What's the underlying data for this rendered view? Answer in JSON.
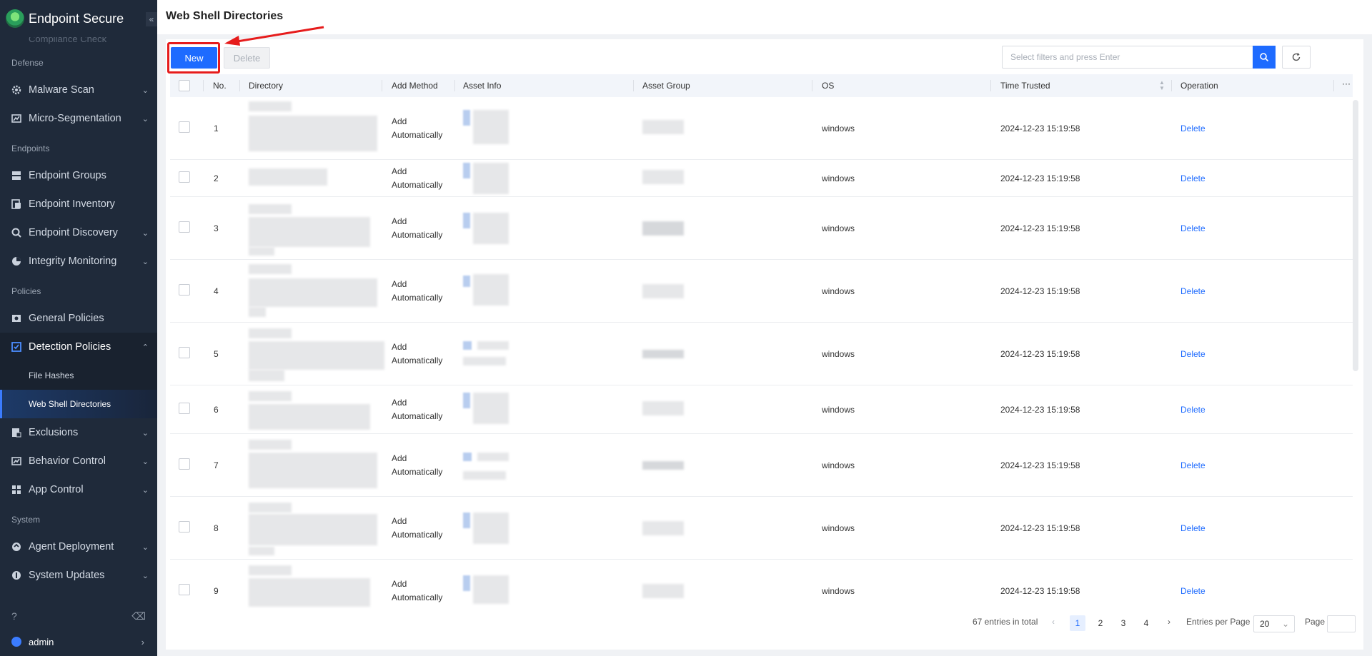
{
  "sidebar": {
    "brand": "Endpoint Secure",
    "collapse_icon": "«",
    "cut_item": "Compliance Check",
    "sections": [
      {
        "label": "Defense",
        "items": [
          {
            "label": "Malware Scan",
            "icon": "gear-icon"
          },
          {
            "label": "Micro-Segmentation",
            "icon": "segment-icon"
          }
        ]
      },
      {
        "label": "Endpoints",
        "items": [
          {
            "label": "Endpoint Groups",
            "icon": "groups-icon"
          },
          {
            "label": "Endpoint Inventory",
            "icon": "inventory-icon"
          },
          {
            "label": "Endpoint Discovery",
            "icon": "discovery-icon"
          },
          {
            "label": "Integrity Monitoring",
            "icon": "pie-icon"
          }
        ]
      },
      {
        "label": "Policies",
        "items": [
          {
            "label": "General Policies",
            "icon": "policy-icon"
          },
          {
            "label": "Detection Policies",
            "icon": "detection-icon"
          }
        ]
      }
    ],
    "detection_sub": [
      "File Hashes",
      "Web Shell Directories"
    ],
    "policies_more": [
      {
        "label": "Exclusions",
        "icon": "exclusions-icon"
      },
      {
        "label": "Behavior Control",
        "icon": "behavior-icon"
      },
      {
        "label": "App Control",
        "icon": "app-icon"
      }
    ],
    "system_label": "System",
    "system_items": [
      {
        "label": "Agent Deployment",
        "icon": "deploy-icon"
      },
      {
        "label": "System Updates",
        "icon": "update-icon"
      }
    ],
    "user": "admin"
  },
  "header": {
    "title": "Web Shell Directories"
  },
  "toolbar": {
    "new_label": "New",
    "delete_label": "Delete",
    "search_placeholder": "Select filters and press Enter"
  },
  "table": {
    "columns": [
      "No.",
      "Directory",
      "Add Method",
      "Asset Info",
      "Asset Group",
      "OS",
      "Time Trusted",
      "Operation"
    ],
    "more": "···",
    "rows": [
      {
        "no": "1",
        "method1": "Add",
        "method2": "Automatically",
        "os": "windows",
        "time": "2024-12-23 15:19:58",
        "op": "Delete"
      },
      {
        "no": "2",
        "method1": "Add",
        "method2": "Automatically",
        "os": "windows",
        "time": "2024-12-23 15:19:58",
        "op": "Delete"
      },
      {
        "no": "3",
        "method1": "Add",
        "method2": "Automatically",
        "os": "windows",
        "time": "2024-12-23 15:19:58",
        "op": "Delete"
      },
      {
        "no": "4",
        "method1": "Add",
        "method2": "Automatically",
        "os": "windows",
        "time": "2024-12-23 15:19:58",
        "op": "Delete"
      },
      {
        "no": "5",
        "method1": "Add",
        "method2": "Automatically",
        "os": "windows",
        "time": "2024-12-23 15:19:58",
        "op": "Delete"
      },
      {
        "no": "6",
        "method1": "Add",
        "method2": "Automatically",
        "os": "windows",
        "time": "2024-12-23 15:19:58",
        "op": "Delete"
      },
      {
        "no": "7",
        "method1": "Add",
        "method2": "Automatically",
        "os": "windows",
        "time": "2024-12-23 15:19:58",
        "op": "Delete"
      },
      {
        "no": "8",
        "method1": "Add",
        "method2": "Automatically",
        "os": "windows",
        "time": "2024-12-23 15:19:58",
        "op": "Delete"
      },
      {
        "no": "9",
        "method1": "Add",
        "method2": "Automatically",
        "os": "windows",
        "time": "2024-12-23 15:19:58",
        "op": "Delete"
      }
    ]
  },
  "pagination": {
    "total": "67 entries in total",
    "prev": "‹",
    "next": "›",
    "pages": [
      "1",
      "2",
      "3",
      "4"
    ],
    "per_page_label": "Entries per Page",
    "per_page": "20",
    "page_label": "Page"
  },
  "colors": {
    "accent": "#1e6bff",
    "sidebar": "#1f2a3a",
    "highlight": "#e61c1c"
  }
}
